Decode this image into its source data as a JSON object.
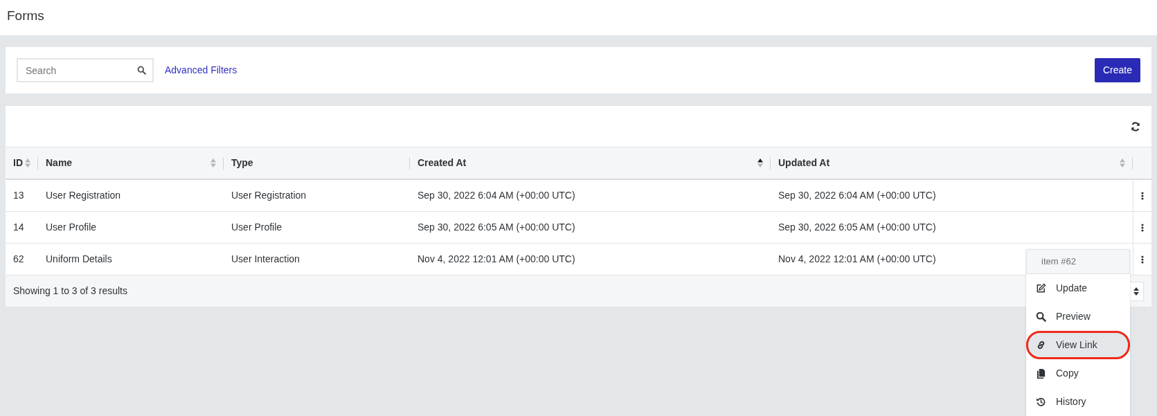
{
  "page_title": "Forms",
  "toolbar": {
    "search": {
      "placeholder": "Search"
    },
    "advanced_filters": "Advanced Filters",
    "create_button": "Create"
  },
  "table": {
    "columns": [
      {
        "label": "ID",
        "sortable": true,
        "sorted": false
      },
      {
        "label": "Name",
        "sortable": true,
        "sorted": false
      },
      {
        "label": "Type",
        "sortable": false
      },
      {
        "label": "Created At",
        "sortable": true,
        "sorted": true
      },
      {
        "label": "Updated At",
        "sortable": true,
        "sorted": false
      }
    ],
    "rows": [
      {
        "cells": [
          "13",
          "User Registration",
          "User Registration",
          "Sep 30, 2022 6:04 AM (+00:00 UTC)",
          "Sep 30, 2022 6:04 AM (+00:00 UTC)"
        ]
      },
      {
        "cells": [
          "14",
          "User Profile",
          "User Profile",
          "Sep 30, 2022 6:05 AM (+00:00 UTC)",
          "Sep 30, 2022 6:05 AM (+00:00 UTC)"
        ]
      },
      {
        "cells": [
          "62",
          "Uniform Details",
          "User Interaction",
          "Nov 4, 2022 12:01 AM (+00:00 UTC)",
          "Nov 4, 2022 12:01 AM (+00:00 UTC)"
        ]
      }
    ],
    "footer": "Showing 1 to 3 of 3 results"
  },
  "row_menu": {
    "header": "item #62",
    "items": [
      {
        "kind": "edit",
        "label": "Update",
        "selected": false,
        "circled": false
      },
      {
        "kind": "search",
        "label": "Preview",
        "selected": false,
        "circled": false
      },
      {
        "kind": "link",
        "label": "View Link",
        "selected": true,
        "circled": true
      },
      {
        "kind": "copy",
        "label": "Copy",
        "selected": false,
        "circled": false
      },
      {
        "kind": "history",
        "label": "History",
        "selected": false,
        "circled": false
      }
    ]
  }
}
